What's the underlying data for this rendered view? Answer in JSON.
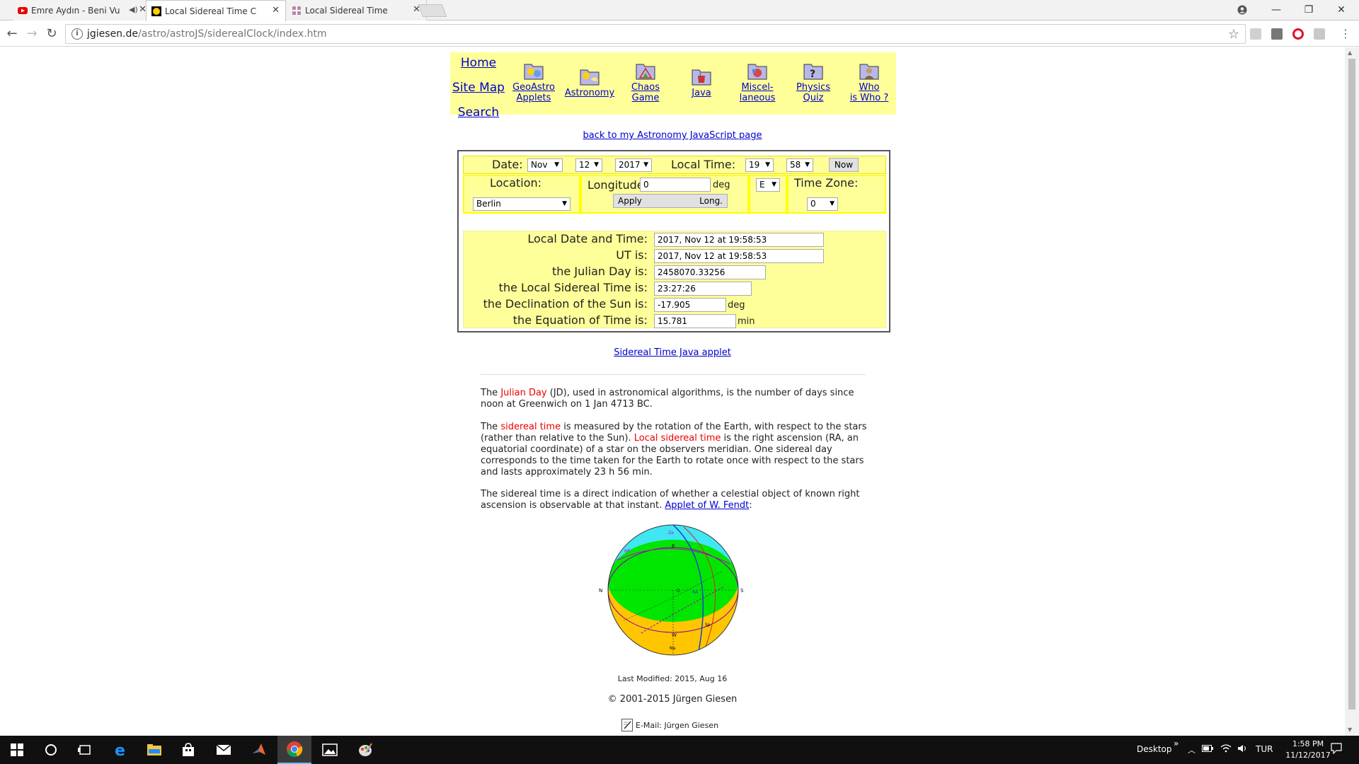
{
  "browser": {
    "tabs": [
      {
        "title": "Emre Aydın - Beni Vu",
        "favicon": "youtube-icon",
        "audio": true
      },
      {
        "title": "Local Sidereal Time Clock",
        "favicon": "giesen-sun-icon",
        "active": true
      },
      {
        "title": "Local Sidereal Time",
        "favicon": "site-icon"
      }
    ],
    "url_domain": "jgiesen.de",
    "url_path": "/astro/astroJS/siderealClock/index.htm"
  },
  "nav": {
    "side_links": [
      "Home",
      "Site Map",
      "Search"
    ],
    "icons": [
      {
        "label": "GeoAstro\nApplets",
        "icon": "geoastro-folder-icon"
      },
      {
        "label": "Astronomy",
        "icon": "astronomy-folder-icon"
      },
      {
        "label": "Chaos\nGame",
        "icon": "chaos-folder-icon"
      },
      {
        "label": "Java",
        "icon": "java-folder-icon"
      },
      {
        "label": "Miscel-\nlaneous",
        "icon": "misc-folder-icon"
      },
      {
        "label": "Physics\nQuiz",
        "icon": "physics-folder-icon"
      },
      {
        "label": "Who\nis Who ?",
        "icon": "who-folder-icon"
      }
    ],
    "colors": {
      "banner": "#ffff99",
      "link": "#0000cc"
    }
  },
  "back_link": "back to my Astronomy JavaScript page",
  "controls": {
    "date_label": "Date:",
    "month": "Nov",
    "day": "12",
    "year": "2017",
    "local_time_label": "Local Time:",
    "hour": "19",
    "minute": "58",
    "now_button": "Now",
    "location_label": "Location:",
    "location": "Berlin",
    "longitude_label": "Longitude",
    "longitude_value": "0",
    "deg_unit": "deg",
    "ew": "E",
    "apply_button": "Apply",
    "long_button": "Long.",
    "timezone_label": "Time Zone:",
    "timezone": "0"
  },
  "results": [
    {
      "label": "Local Date and Time:",
      "value": "2017, Nov 12 at  19:58:53",
      "unit": ""
    },
    {
      "label": "UT is:",
      "value": "2017, Nov 12 at  19:58:53",
      "unit": ""
    },
    {
      "label": "the Julian Day is:",
      "value": "2458070.33256",
      "unit": ""
    },
    {
      "label": "the Local Sidereal Time is:",
      "value": "23:27:26",
      "unit": ""
    },
    {
      "label": "the Declination of the Sun is:",
      "value": "-17.905",
      "unit": "deg"
    },
    {
      "label": "the Equation of Time is:",
      "value": "15.781",
      "unit": "min"
    }
  ],
  "applet_link": "Sidereal Time Java applet",
  "paragraphs": {
    "p1_a": "The ",
    "p1_red": "Julian Day",
    "p1_b": " (JD), used in astronomical algorithms, is the number of days since noon at Greenwich on 1 Jan 4713 BC.",
    "p2_a": "The ",
    "p2_red1": "sidereal time",
    "p2_b": " is measured by the rotation of the Earth, with respect to the stars (rather than relative to the Sun). ",
    "p2_red2": "Local sidereal time",
    "p2_c": " is the right ascension (RA, an equatorial coordinate) of a star on the observers meridian. One sidereal day corresponds to the time taken for the Earth to rotate once with respect to the stars and lasts approximately 23 h 56 min.",
    "p3_a": "The sidereal time is a direct indication of whether a celestial object of known right ascension is observable at that instant. ",
    "p3_link": "Applet of W. Fendt",
    "p3_b": ":"
  },
  "globe_labels": {
    "n": "N",
    "s": "S",
    "e": "E",
    "w": "W",
    "o": "O",
    "ze": "Ze",
    "np": "NP",
    "ra": "RA",
    "sp": "Sp",
    "na": "Na"
  },
  "footer": {
    "modified": "Last Modified: 2015, Aug 16",
    "copyright": "© 2001-2015 Jürgen Giesen",
    "email": "E-Mail: Jürgen Giesen"
  },
  "taskbar": {
    "apps": [
      "windows-start-icon",
      "cortana-icon",
      "task-view-icon",
      "edge-icon",
      "file-explorer-icon",
      "store-icon",
      "mail-icon",
      "matlab-icon",
      "chrome-icon",
      "photos-icon",
      "paint-icon"
    ],
    "desktop_label": "Desktop",
    "chevron": "»",
    "lang": "TUR",
    "time": "1:58 PM",
    "date": "11/12/2017"
  }
}
